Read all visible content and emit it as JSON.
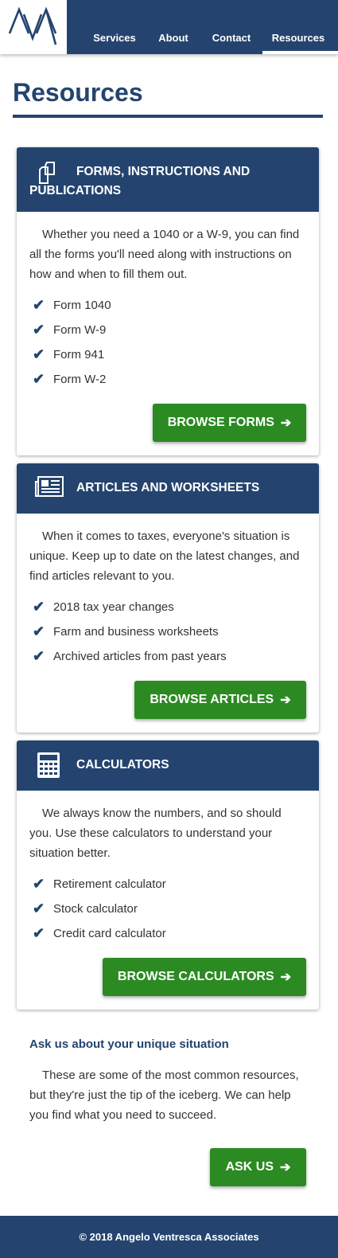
{
  "header": {
    "logo_text": "AVA",
    "nav": [
      {
        "label": "Services"
      },
      {
        "label": "About"
      },
      {
        "label": "Contact"
      },
      {
        "label": "Resources",
        "active": true
      }
    ]
  },
  "page_title": "Resources",
  "cards": [
    {
      "icon": "documents-icon",
      "title": "FORMS, INSTRUCTIONS AND PUBLICATIONS",
      "description": "Whether you need a 1040 or a W-9, you can find all the forms you'll need along with instructions on how and when to fill them out.",
      "items": [
        "Form 1040",
        "Form W-9",
        "Form 941",
        "Form W-2"
      ],
      "button": "BROWSE FORMS"
    },
    {
      "icon": "newspaper-icon",
      "title": "ARTICLES AND WORKSHEETS",
      "description": "When it comes to taxes, everyone's situation is unique. Keep up to date on the latest changes, and find articles relevant to you.",
      "items": [
        "2018 tax year changes",
        "Farm and business worksheets",
        "Archived articles from past years"
      ],
      "button": "BROWSE ARTICLES"
    },
    {
      "icon": "calculator-icon",
      "title": "CALCULATORS",
      "description": "We always know the numbers, and so should you. Use these calculators to understand your situation better.",
      "items": [
        "Retirement calculator",
        "Stock calculator",
        "Credit card calculator"
      ],
      "button": "BROWSE CALCULATORS"
    }
  ],
  "ask": {
    "heading": "Ask us about your unique situation",
    "description": "These are some of the most common resources, but they're just the tip of the iceberg. We can help you find what you need to succeed.",
    "button": "ASK US"
  },
  "footer": "© 2018 Angelo Ventresca Associates",
  "glyphs": {
    "check": "✔",
    "arrow": "➔"
  },
  "colors": {
    "brand": "#24446f",
    "button": "#2c8a22"
  }
}
